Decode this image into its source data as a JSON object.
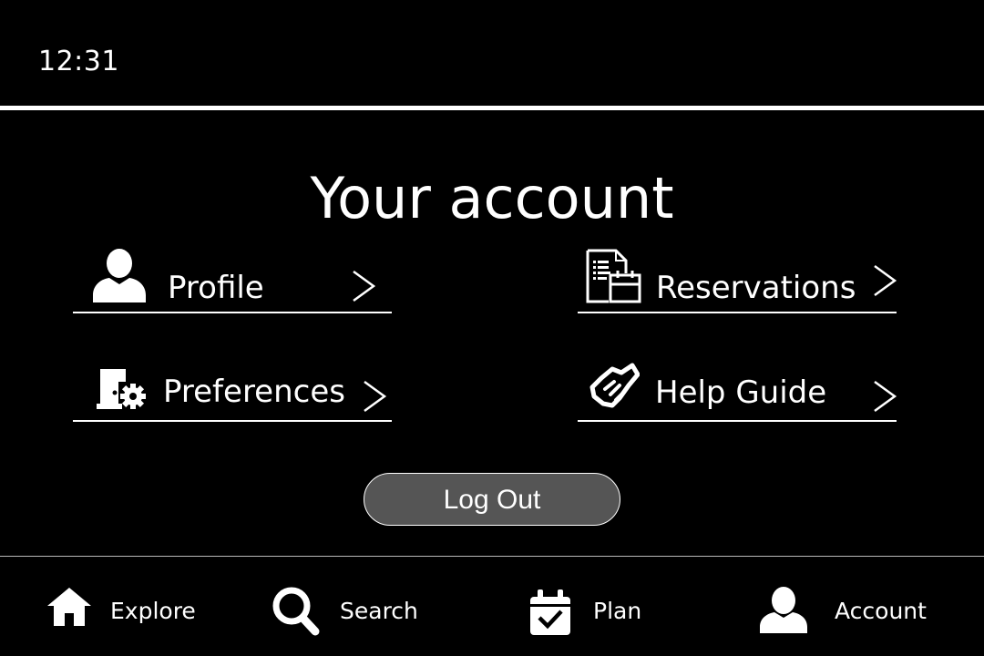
{
  "status_bar": {
    "time": "12:31"
  },
  "page": {
    "title": "Your account"
  },
  "menu": [
    {
      "label": "Profile",
      "icon": "person-icon"
    },
    {
      "label": "Reservations",
      "icon": "reservations-icon"
    },
    {
      "label": "Preferences",
      "icon": "preferences-icon"
    },
    {
      "label": "Help Guide",
      "icon": "handshake-icon"
    }
  ],
  "logout": {
    "label": "Log Out"
  },
  "nav": [
    {
      "label": "Explore",
      "icon": "home-icon"
    },
    {
      "label": "Search",
      "icon": "search-icon"
    },
    {
      "label": "Plan",
      "icon": "calendar-check-icon"
    },
    {
      "label": "Account",
      "icon": "person-icon"
    }
  ],
  "colors": {
    "background": "#000000",
    "foreground": "#ffffff",
    "button": "#555555"
  }
}
